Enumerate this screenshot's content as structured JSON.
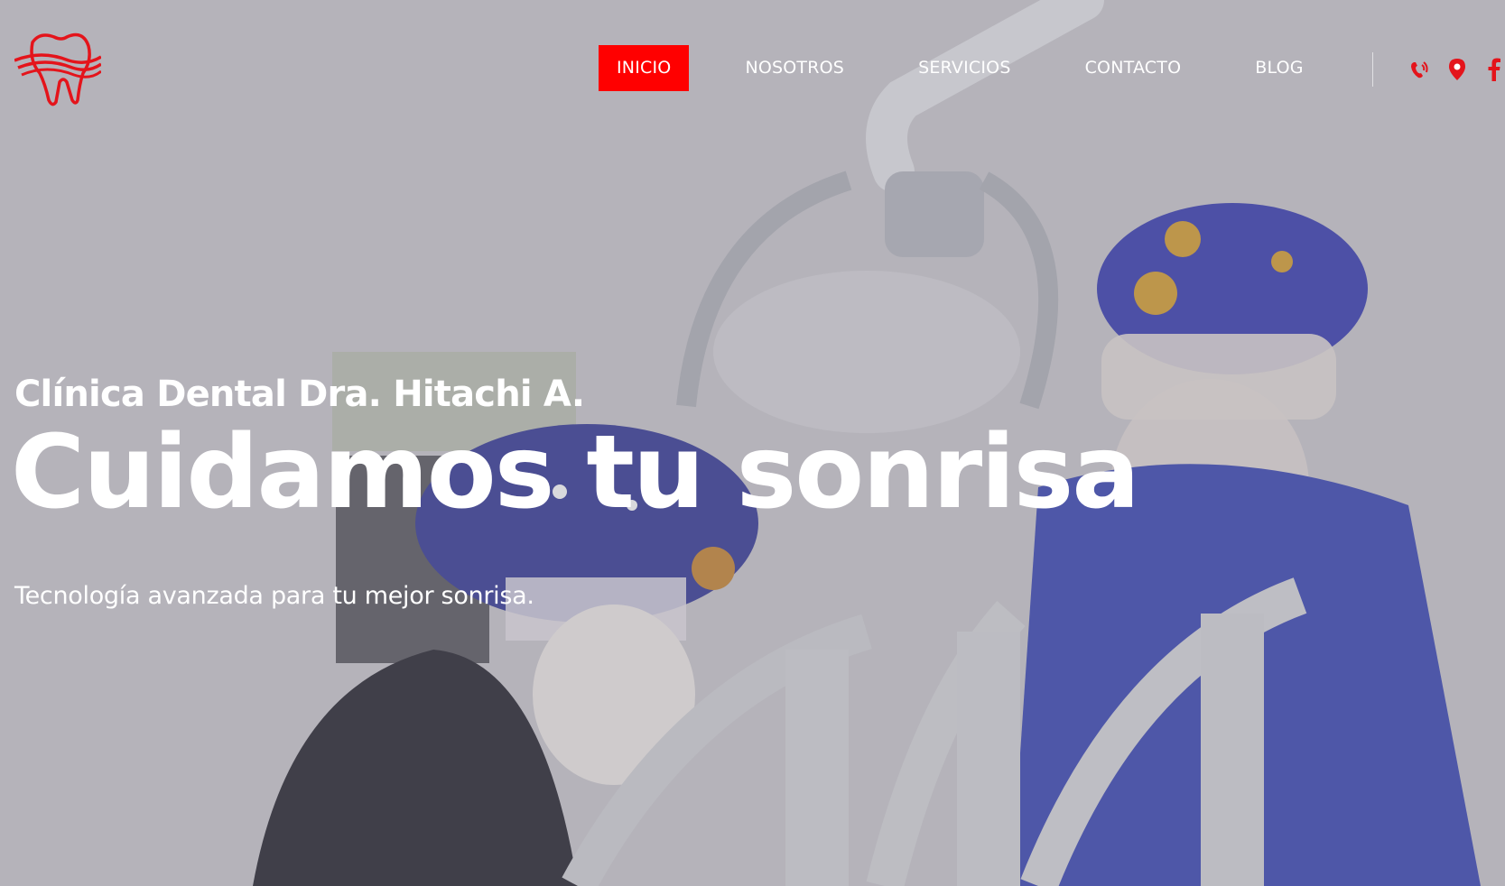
{
  "brand": {
    "accent_color": "#ff0000",
    "logo_icon": "tooth-logo-icon"
  },
  "nav": {
    "items": [
      {
        "label": "INICIO",
        "active": true
      },
      {
        "label": "NOSOTROS",
        "active": false
      },
      {
        "label": "SERVICIOS",
        "active": false
      },
      {
        "label": "CONTACTO",
        "active": false
      },
      {
        "label": "BLOG",
        "active": false
      }
    ]
  },
  "social": {
    "icons": [
      "phone-icon",
      "location-pin-icon",
      "facebook-icon"
    ]
  },
  "hero": {
    "subtitle": "Clínica Dental Dra. Hitachi A.",
    "title": "Cuidamos tu sonrisa",
    "tagline": "Tecnología avanzada para tu mejor sonrisa."
  }
}
